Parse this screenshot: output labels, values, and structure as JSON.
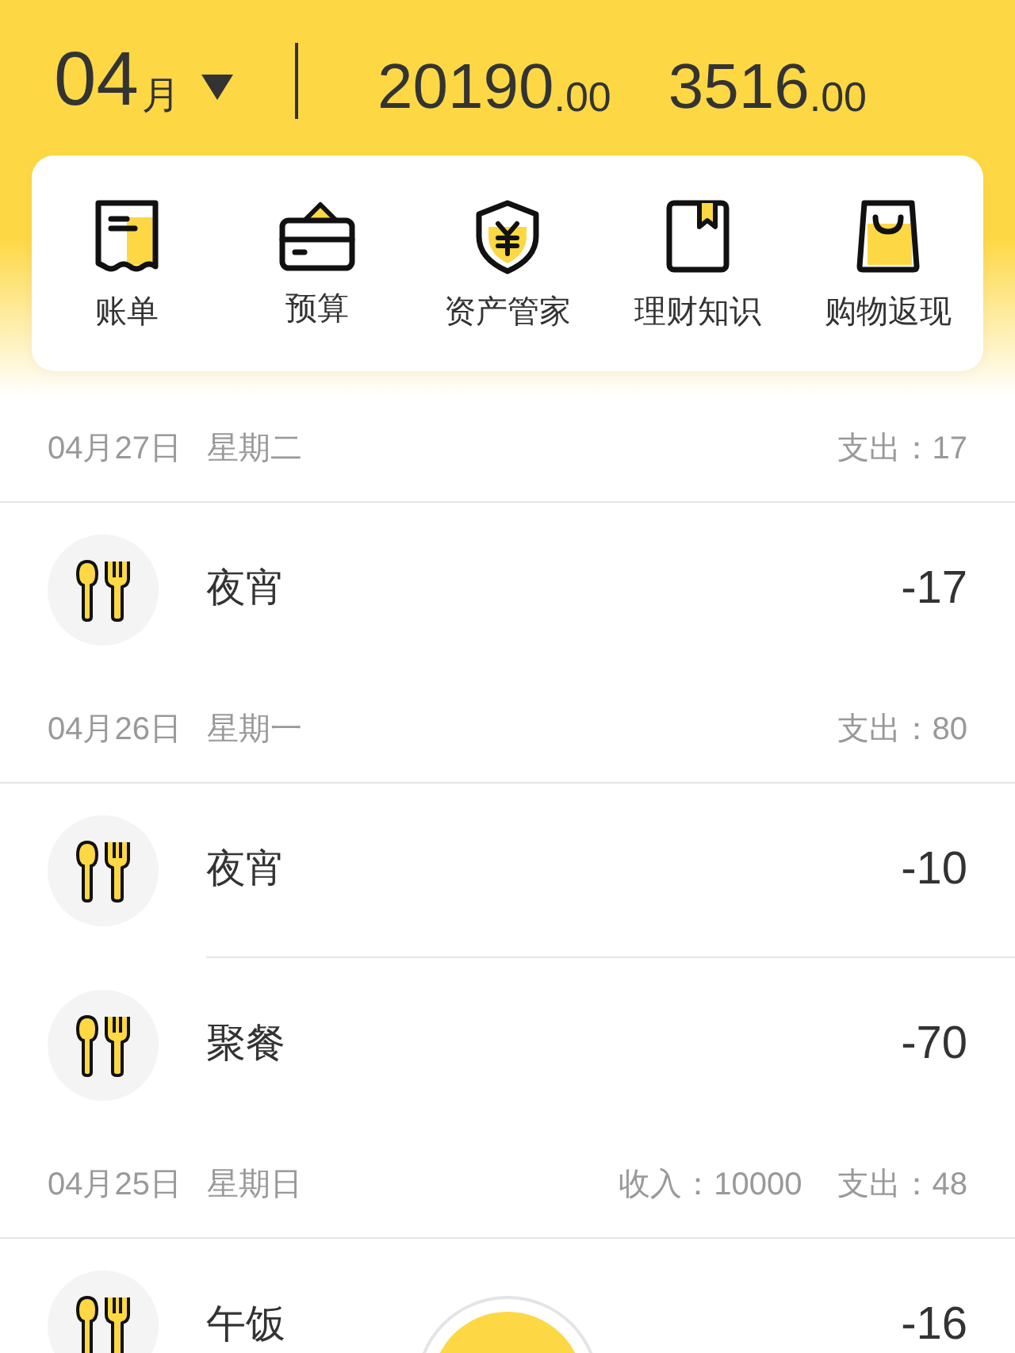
{
  "header": {
    "month": "04",
    "month_unit": "月",
    "amounts": [
      {
        "whole": "20190",
        "decimal": ".00"
      },
      {
        "whole": "3516",
        "decimal": ".00"
      }
    ]
  },
  "shortcuts": [
    {
      "label": "账单",
      "kind": "receipt"
    },
    {
      "label": "预算",
      "kind": "wallet"
    },
    {
      "label": "资产管家",
      "kind": "shield"
    },
    {
      "label": "理财知识",
      "kind": "book"
    },
    {
      "label": "购物返现",
      "kind": "bag"
    }
  ],
  "days": [
    {
      "date": "04月27日",
      "weekday": "星期二",
      "totals": [
        {
          "label": "支出：",
          "value": "17"
        }
      ],
      "entries": [
        {
          "name": "夜宵",
          "amount": "-17",
          "kind": "food"
        }
      ]
    },
    {
      "date": "04月26日",
      "weekday": "星期一",
      "totals": [
        {
          "label": "支出：",
          "value": "80"
        }
      ],
      "entries": [
        {
          "name": "夜宵",
          "amount": "-10",
          "kind": "food"
        },
        {
          "name": "聚餐",
          "amount": "-70",
          "kind": "food"
        }
      ]
    },
    {
      "date": "04月25日",
      "weekday": "星期日",
      "totals": [
        {
          "label": "收入：",
          "value": "10000"
        },
        {
          "label": "支出：",
          "value": "48"
        }
      ],
      "entries": [
        {
          "name": "午饭",
          "amount": "-16",
          "kind": "food"
        }
      ]
    }
  ]
}
